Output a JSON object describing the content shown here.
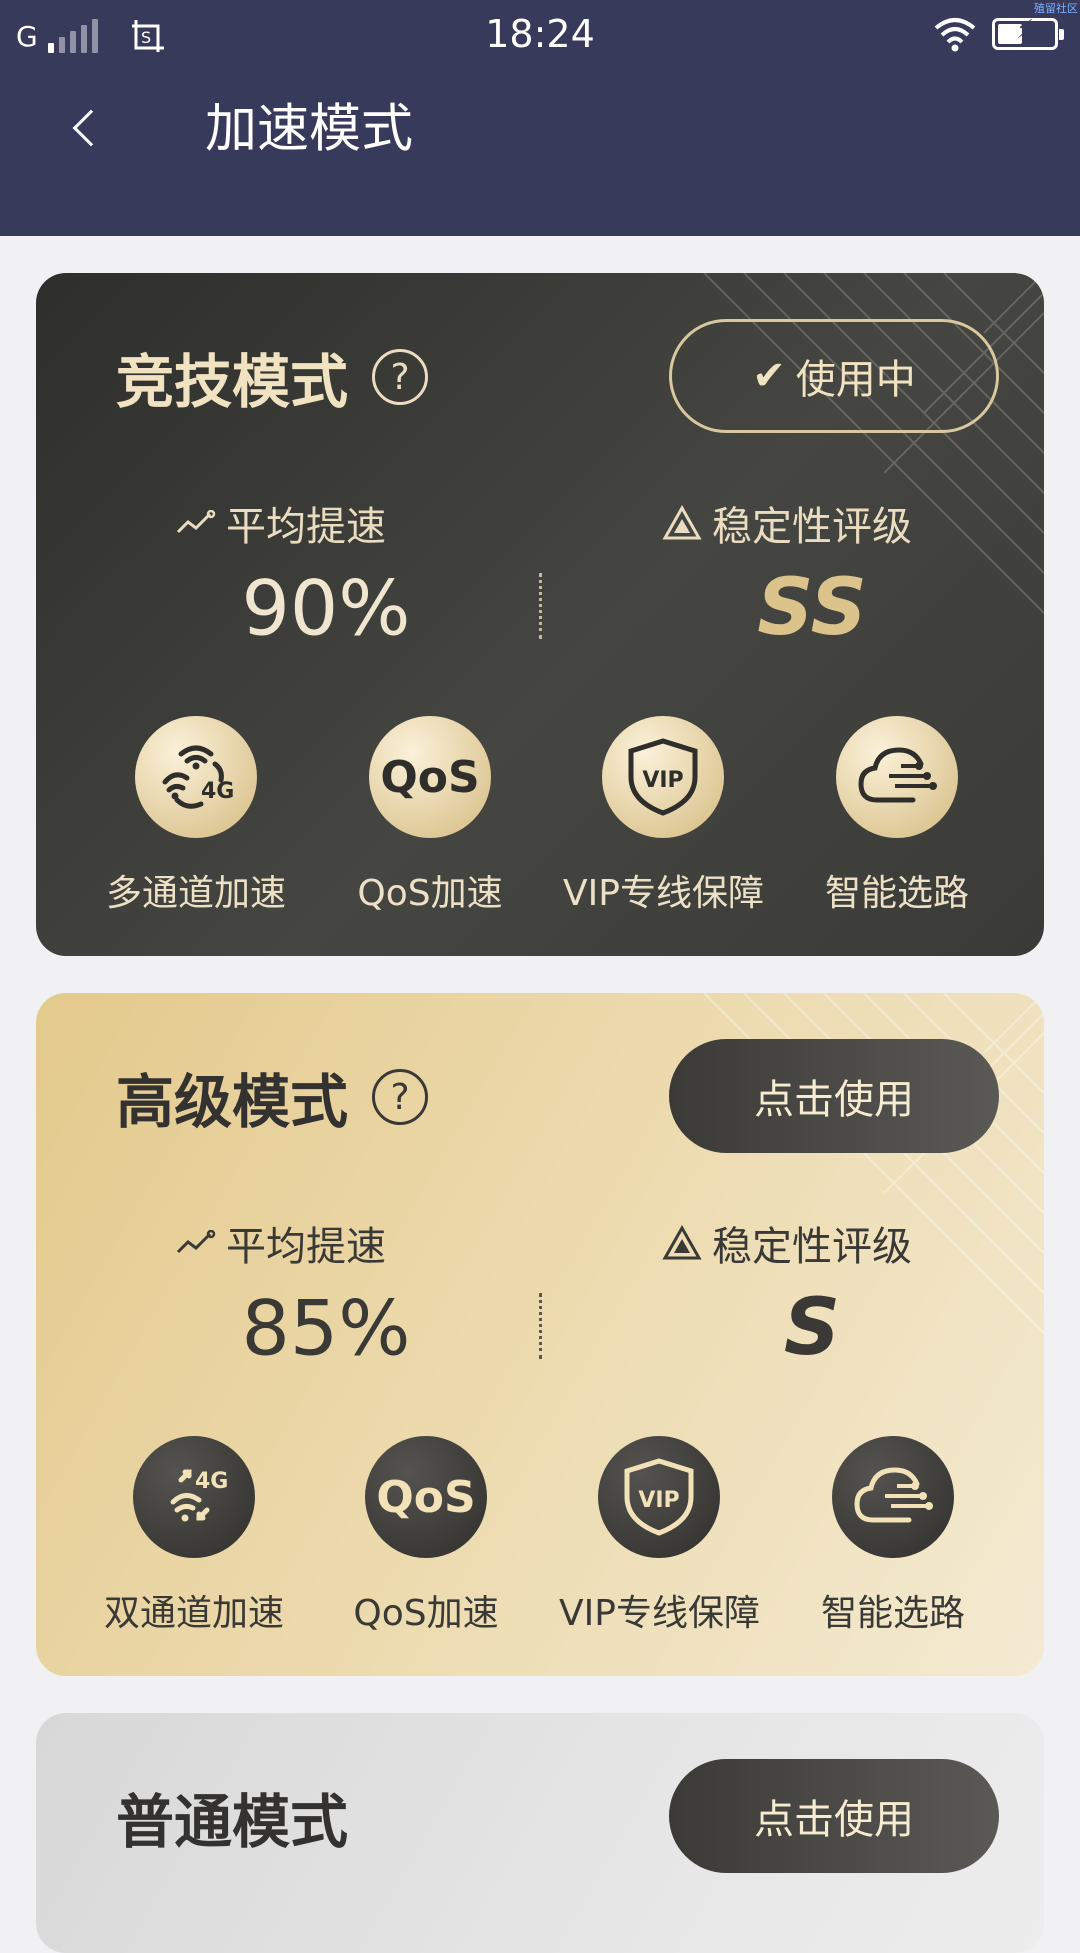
{
  "status_bar": {
    "network": "G",
    "time": "18:24",
    "corner_tag": "殖留社区"
  },
  "header": {
    "title": "加速模式"
  },
  "modes": [
    {
      "name": "竞技模式",
      "button": "使用中",
      "avg_speed_label": "平均提速",
      "avg_speed_value": "90%",
      "stability_label": "稳定性评级",
      "stability_value": "SS",
      "features": [
        "多通道加速",
        "QoS加速",
        "VIP专线保障",
        "智能选路"
      ]
    },
    {
      "name": "高级模式",
      "button": "点击使用",
      "avg_speed_label": "平均提速",
      "avg_speed_value": "85%",
      "stability_label": "稳定性评级",
      "stability_value": "S",
      "features": [
        "双通道加速",
        "QoS加速",
        "VIP专线保障",
        "智能选路"
      ]
    },
    {
      "name": "普通模式",
      "button": "点击使用"
    }
  ],
  "icons": {
    "check": "✔",
    "help": "?",
    "qos": "QoS",
    "vip": "VIP",
    "badge_4g": "4G"
  },
  "colors": {
    "header_bg": "#383a5c",
    "gold_accent": "#dcc38c",
    "dark_card": "#3a3a37"
  }
}
